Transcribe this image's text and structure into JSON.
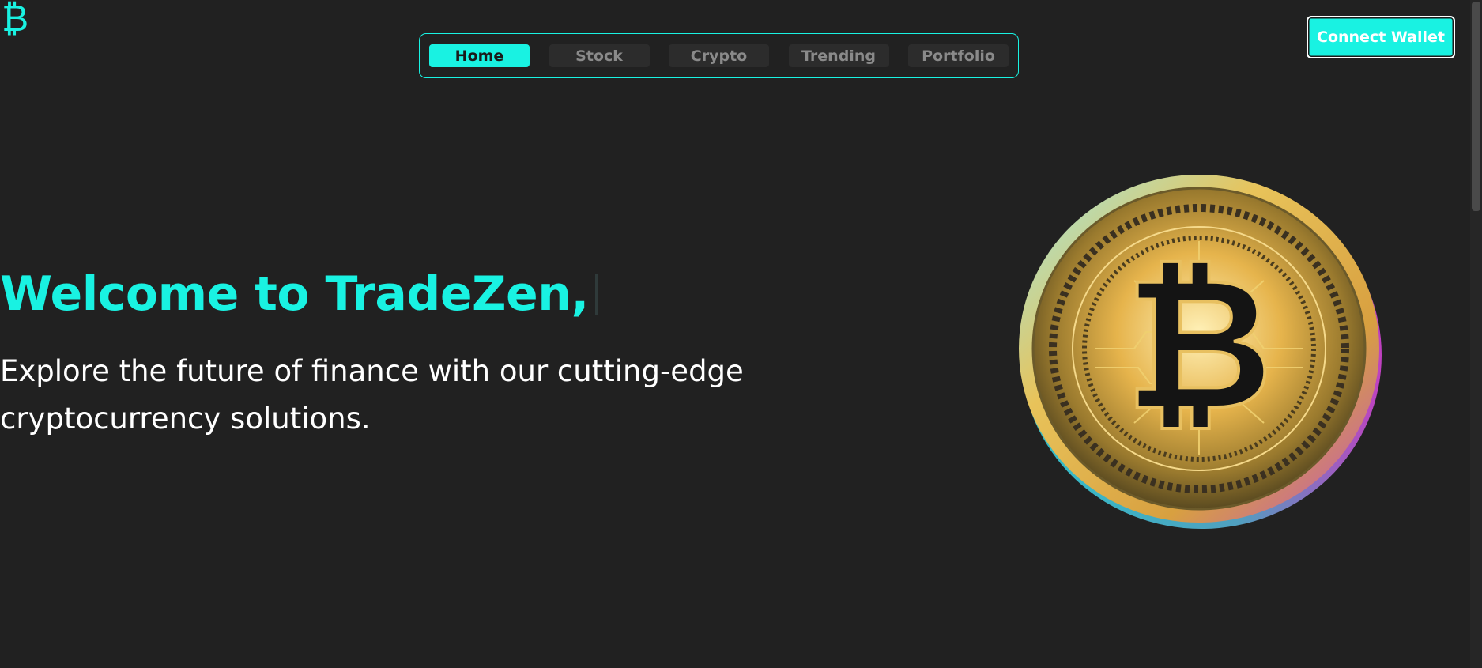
{
  "brand": {
    "logo_glyph": "₿",
    "logo_icon": "bitcoin-icon"
  },
  "nav": {
    "tabs": [
      {
        "label": "Home",
        "active": true
      },
      {
        "label": "Stock",
        "active": false
      },
      {
        "label": "Crypto",
        "active": false
      },
      {
        "label": "Trending",
        "active": false
      },
      {
        "label": "Portfolio",
        "active": false
      }
    ]
  },
  "header": {
    "connect_label": "Connect Wallet"
  },
  "hero": {
    "title": "Welcome to TradeZen,",
    "subtitle": "Explore the future of finance with our cutting-edge cryptocurrency solutions."
  },
  "colors": {
    "accent": "#19f2e2",
    "background": "#212121",
    "tab_inactive_bg": "#2c2c2c",
    "tab_inactive_text": "#8a8a8a",
    "coin_gold": "#e0b24a"
  }
}
